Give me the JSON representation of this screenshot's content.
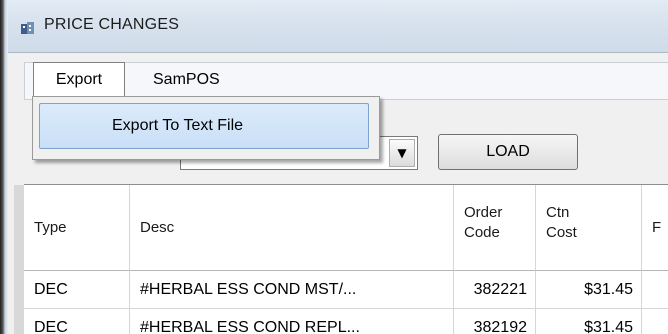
{
  "window": {
    "title": "PRICE CHANGES"
  },
  "menu": {
    "items": [
      {
        "label": "Export"
      },
      {
        "label": "SamPOS"
      }
    ],
    "dropdown": {
      "items": [
        {
          "label": "Export To Text File"
        }
      ]
    }
  },
  "toolbar": {
    "load_label": "LOAD",
    "combo_value": ""
  },
  "grid": {
    "columns": [
      {
        "label": "Type"
      },
      {
        "label": "Desc"
      },
      {
        "label": "Order\nCode"
      },
      {
        "label": "Ctn\nCost"
      },
      {
        "label": "F"
      }
    ],
    "rows": [
      {
        "type": "DEC",
        "desc": "#HERBAL ESS COND MST/...",
        "order_code": "382221",
        "ctn_cost": "$31.45",
        "extra": ""
      },
      {
        "type": "DEC",
        "desc": "#HERBAL ESS COND REPL...",
        "order_code": "382192",
        "ctn_cost": "$31.45",
        "extra": ""
      }
    ]
  },
  "colors": {
    "titlebar": "#d7e2ee",
    "highlight": "#c9dff7",
    "highlight_border": "#7da2ce"
  }
}
